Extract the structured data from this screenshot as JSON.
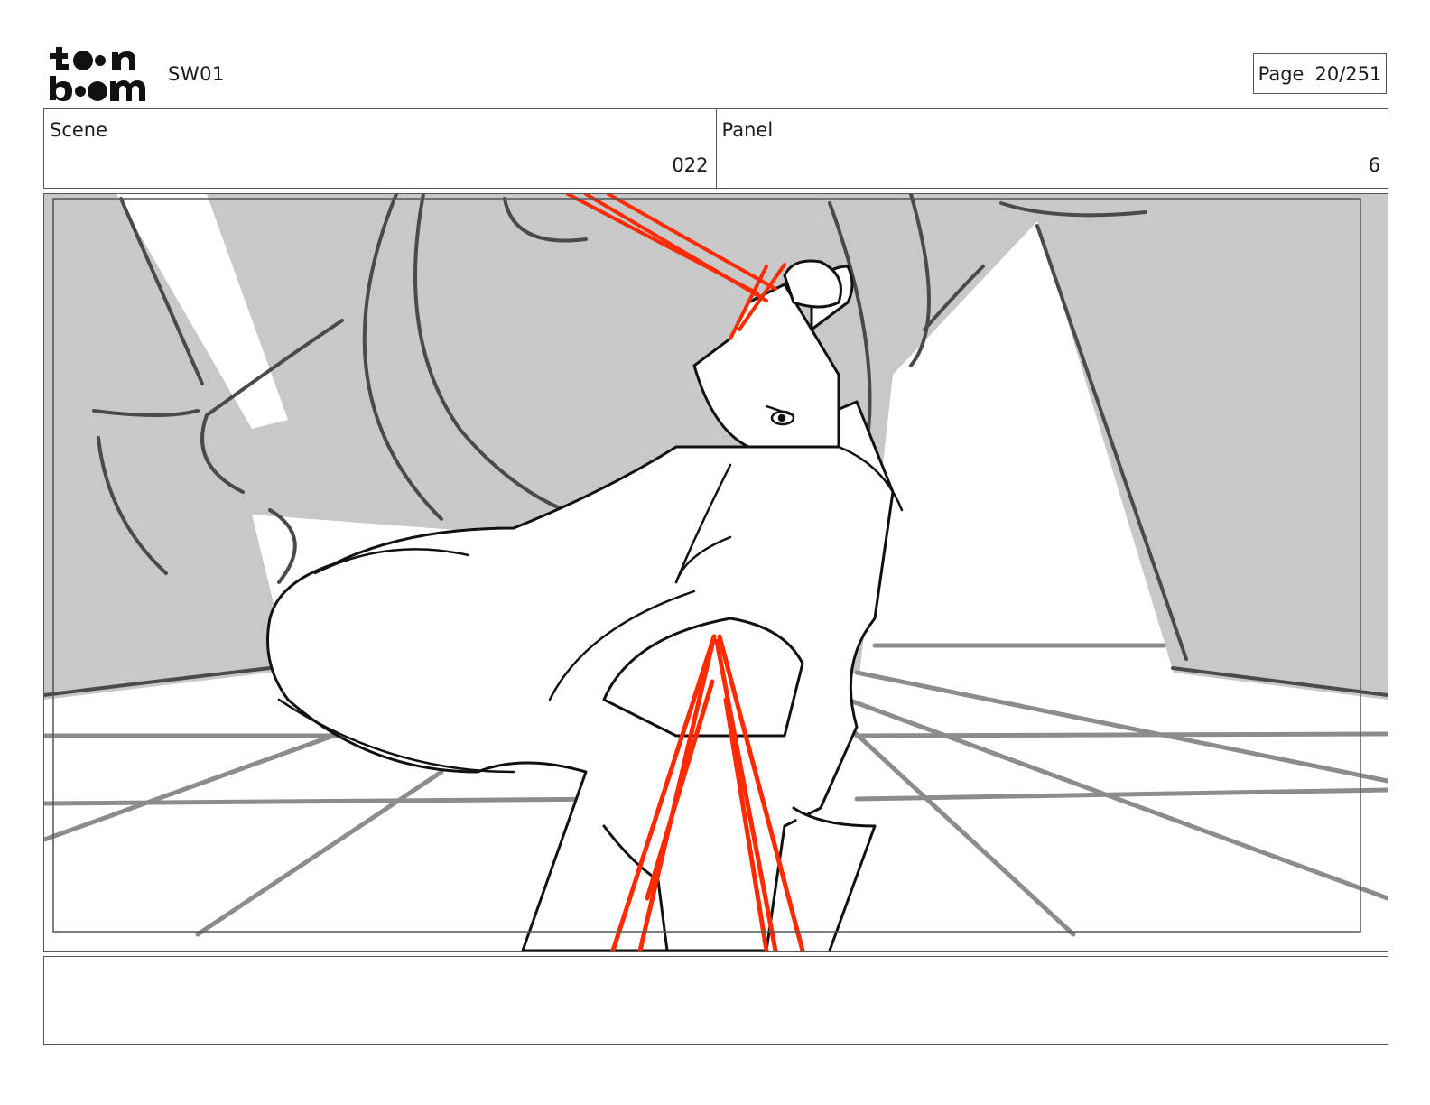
{
  "header": {
    "logo_text": "toon boom",
    "project_title": "SW01",
    "page_label": "Page",
    "page_value": "20/251"
  },
  "info": {
    "scene_label": "Scene",
    "scene_value": "022",
    "panel_label": "Panel",
    "panel_value": "6"
  },
  "panel": {
    "colors": {
      "background_gray": "#c8c8c8",
      "line": "#111111",
      "saber_red": "#ff2a00",
      "floor_line": "#8c8c8c"
    }
  },
  "caption": {
    "text": ""
  }
}
